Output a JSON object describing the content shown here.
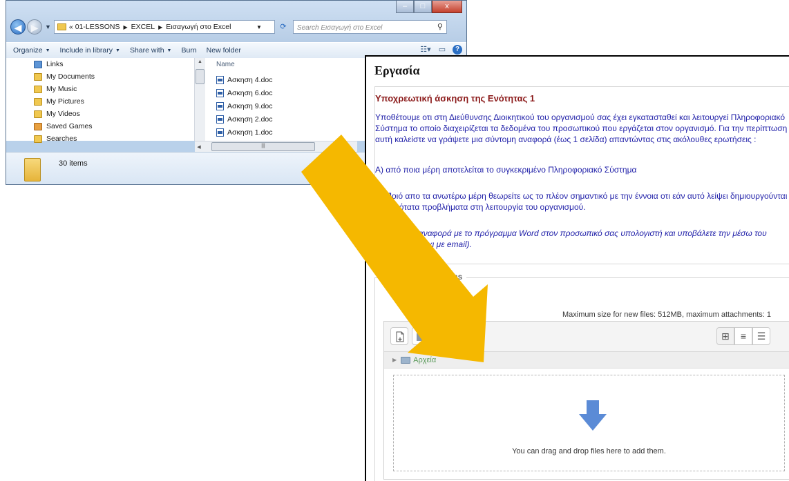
{
  "explorer": {
    "breadcrumb": {
      "prefix": "«",
      "segments": [
        "01-LESSONS",
        "EXCEL",
        "Εισαγωγή στο Excel"
      ]
    },
    "search": {
      "placeholder": "Search Εισαγωγή στο Excel"
    },
    "toolbar": {
      "organize": "Organize",
      "include_library": "Include in library",
      "share_with": "Share with",
      "burn": "Burn",
      "new_folder": "New folder"
    },
    "nav_items": [
      "Links",
      "My Documents",
      "My Music",
      "My Pictures",
      "My Videos",
      "Saved Games",
      "Searches"
    ],
    "files_header": "Name",
    "files": [
      "Ασκηση 4.doc",
      "Ασκηση 6.doc",
      "Ασκηση 9.doc",
      "Ασκηση 2.doc",
      "Ασκηση 1.doc"
    ],
    "item_count": "30 items",
    "window_controls": {
      "minimize": "–",
      "maximize": "□",
      "close": "x"
    }
  },
  "moodle": {
    "title": "Εργασία",
    "intro_heading": "Υποχρεωτική άσκηση της Ενότητας 1",
    "intro_paragraph_1": "Υποθέτουμε οτι στη Διεύθυνσης Διοικητικού του οργανισμού σας έχει εγκατασταθεί και λειτουργεί Πληροφοριακό Σύστημα το οποίο διαχειρίζεται τα δεδομένα του προσωπικού που εργάζεται στον οργανισμό. Για την περίπτωση αυτή καλείστε να γράψετε μια σύντομη αναφορά (έως 1 σελίδα) απαντώντας στις ακόλουθες ερωτήσεις :",
    "intro_question_a": "Α) από ποια μέρη αποτελείται το συγκεκριμένο Πληροφοριακό Σύστημα",
    "intro_question_b": "Β) Ποιό απο τα ανωτέρω μέρη θεωρείτε ως το πλέον σημαντικό με την έννοια οτι εάν αυτό λείψει δημιουργούνται σοβαρότατα προβλήματα στη λειτουργία του οργανισμού.",
    "intro_instructions": "Γράψτε την αναφορά με το πρόγραμμα Word στον προσωπικό σας υπολογιστή και υποβάλετε την μέσω του συστήματος (οχι με email).",
    "fieldset_legend": "File submissions",
    "max_size_text": "Maximum size for new files: 512MB, maximum attachments: 1",
    "folder_label": "Αρχεία",
    "drop_text": "You can drag and drop files here to add them."
  },
  "colors": {
    "arrow": "#f5b800",
    "heading_red": "#8b1a1a",
    "body_blue": "#1f1fa8",
    "drop_arrow": "#5b8bd6"
  },
  "icons": [
    "back-icon",
    "forward-icon",
    "refresh-icon",
    "search-icon",
    "help-icon",
    "add-file-icon",
    "create-folder-icon",
    "icon-view-icon",
    "list-view-icon",
    "tree-view-icon",
    "drop-arrow-icon",
    "drag-arrow-icon"
  ]
}
